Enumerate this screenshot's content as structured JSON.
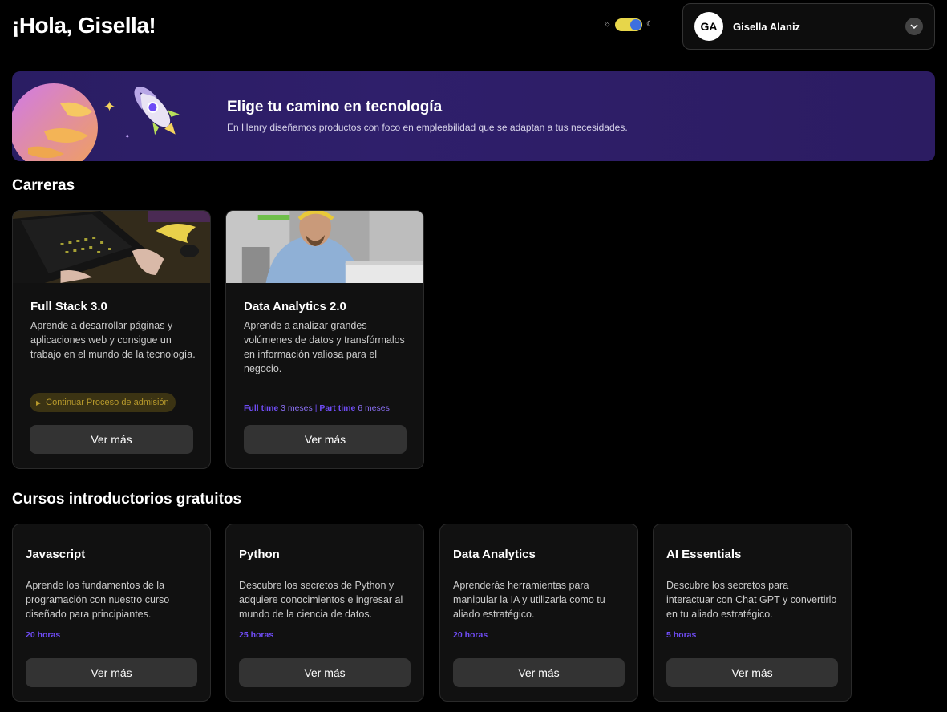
{
  "header": {
    "greeting": "¡Hola, Gisella!",
    "theme_toggle": {
      "mode": "dark",
      "sun_icon": "sun-icon",
      "moon_icon": "moon-icon"
    },
    "user": {
      "initials": "GA",
      "name": "Gisella Alaniz"
    }
  },
  "banner": {
    "title": "Elige tu camino en tecnología",
    "subtitle": "En Henry diseñamos productos con foco en empleabilidad que se adaptan a tus necesidades."
  },
  "careers": {
    "title": "Carreras",
    "items": [
      {
        "title": "Full Stack 3.0",
        "description": "Aprende a desarrollar páginas y aplicaciones web y consigue un trabajo en el mundo de la tecnología.",
        "status": "Continuar Proceso de admisión",
        "button": "Ver más"
      },
      {
        "title": "Data Analytics 2.0",
        "description": "Aprende a analizar grandes volúmenes de datos y transfórmalos en información valiosa para el negocio.",
        "full_time_label": "Full time",
        "full_time_value": "3 meses",
        "separator": "|",
        "part_time_label": "Part time",
        "part_time_value": "6 meses",
        "button": "Ver más"
      }
    ]
  },
  "courses": {
    "title": "Cursos introductorios gratuitos",
    "items": [
      {
        "title": "Javascript",
        "description": "Aprende los fundamentos de la programación con nuestro curso diseñado para principiantes.",
        "duration": "20 horas",
        "button": "Ver más"
      },
      {
        "title": "Python",
        "description": "Descubre los secretos de Python y adquiere conocimientos e ingresar al mundo de la ciencia de datos.",
        "duration": "25 horas",
        "button": "Ver más"
      },
      {
        "title": "Data Analytics",
        "description": "Aprenderás herramientas para manipular la IA y utilizarla como tu aliado estratégico.",
        "duration": "20 horas",
        "button": "Ver más"
      },
      {
        "title": "AI Essentials",
        "description": "Descubre los secretos para interactuar con Chat GPT y convertirlo en tu aliado estratégico.",
        "duration": "5 horas",
        "button": "Ver más"
      }
    ]
  },
  "colors": {
    "accent_purple": "#6f4cf5",
    "banner_bg": "#2c1c62",
    "status_gold": "#b89a2c",
    "toggle_yellow": "#e7d64a",
    "toggle_blue": "#3d6fe0"
  }
}
